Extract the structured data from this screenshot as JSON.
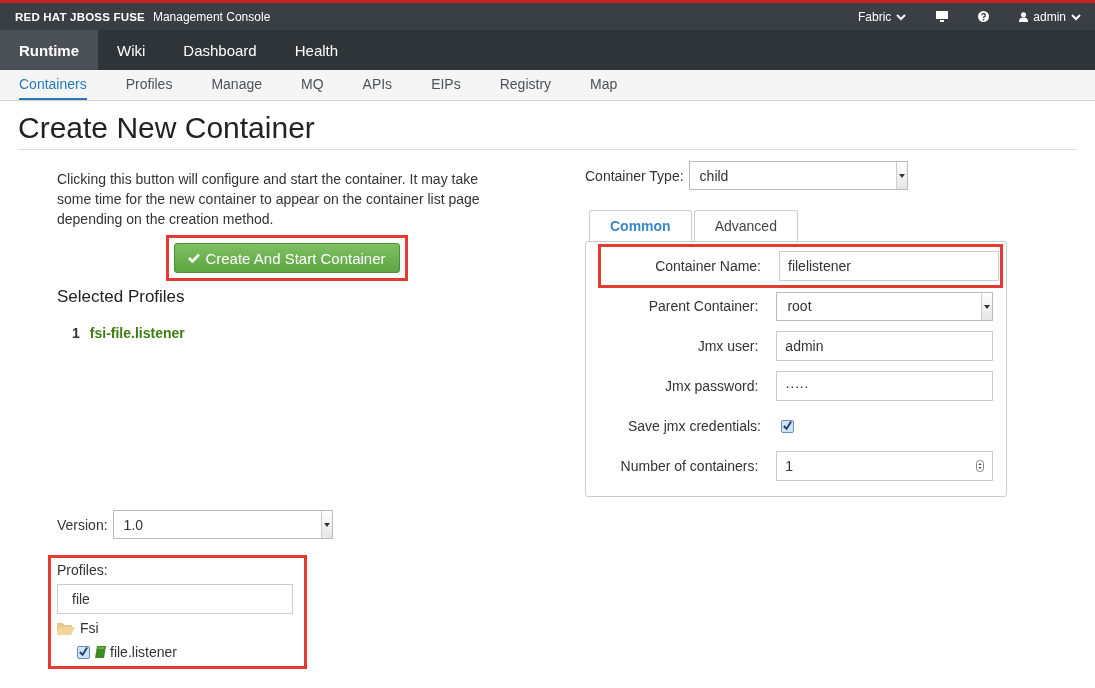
{
  "header": {
    "brand": "RED HAT JBOSS FUSE",
    "product": "Management Console",
    "menus": [
      {
        "kind": "dropdown",
        "label": "Fabric"
      },
      {
        "kind": "monitor"
      },
      {
        "kind": "help"
      },
      {
        "kind": "user",
        "label": "admin"
      }
    ]
  },
  "main_nav": [
    {
      "label": "Runtime",
      "selected": true
    },
    {
      "label": "Wiki",
      "selected": false
    },
    {
      "label": "Dashboard",
      "selected": false
    },
    {
      "label": "Health",
      "selected": false
    }
  ],
  "sub_nav": [
    {
      "label": "Containers",
      "selected": true
    },
    {
      "label": "Profiles",
      "selected": false
    },
    {
      "label": "Manage",
      "selected": false
    },
    {
      "label": "MQ",
      "selected": false
    },
    {
      "label": "APIs",
      "selected": false
    },
    {
      "label": "EIPs",
      "selected": false
    },
    {
      "label": "Registry",
      "selected": false
    },
    {
      "label": "Map",
      "selected": false
    }
  ],
  "page_title": "Create New Container",
  "description": "Clicking this button will configure and start the container. It may take some time for the new container to appear on the container list page depending on the creation method.",
  "create_button": "Create And Start Container",
  "selected_profiles": {
    "title": "Selected Profiles",
    "items": [
      {
        "index": "1",
        "name": "fsi-file.listener"
      }
    ]
  },
  "container_type": {
    "label": "Container Type:",
    "value": "child"
  },
  "tabs": [
    {
      "label": "Common",
      "selected": true
    },
    {
      "label": "Advanced",
      "selected": false
    }
  ],
  "fields": [
    {
      "kind": "text",
      "label": "Container Name:",
      "value": "filelistener",
      "highlighted": true
    },
    {
      "kind": "select",
      "label": "Parent Container:",
      "value": "root",
      "highlighted": false
    },
    {
      "kind": "text",
      "label": "Jmx user:",
      "value": "admin",
      "highlighted": false
    },
    {
      "kind": "password",
      "label": "Jmx password:",
      "value": "·····",
      "highlighted": false
    },
    {
      "kind": "checkbox",
      "label": "Save jmx credentials:",
      "checked": true,
      "highlighted": false
    },
    {
      "kind": "number",
      "label": "Number of containers:",
      "value": "1",
      "highlighted": false
    }
  ],
  "version": {
    "label": "Version:",
    "value": "1.0"
  },
  "profiles": {
    "label": "Profiles:",
    "filter": "file",
    "tree": [
      {
        "label": "Fsi",
        "expanded": true,
        "children": [
          {
            "label": "file.listener",
            "checked": true
          }
        ]
      }
    ]
  }
}
